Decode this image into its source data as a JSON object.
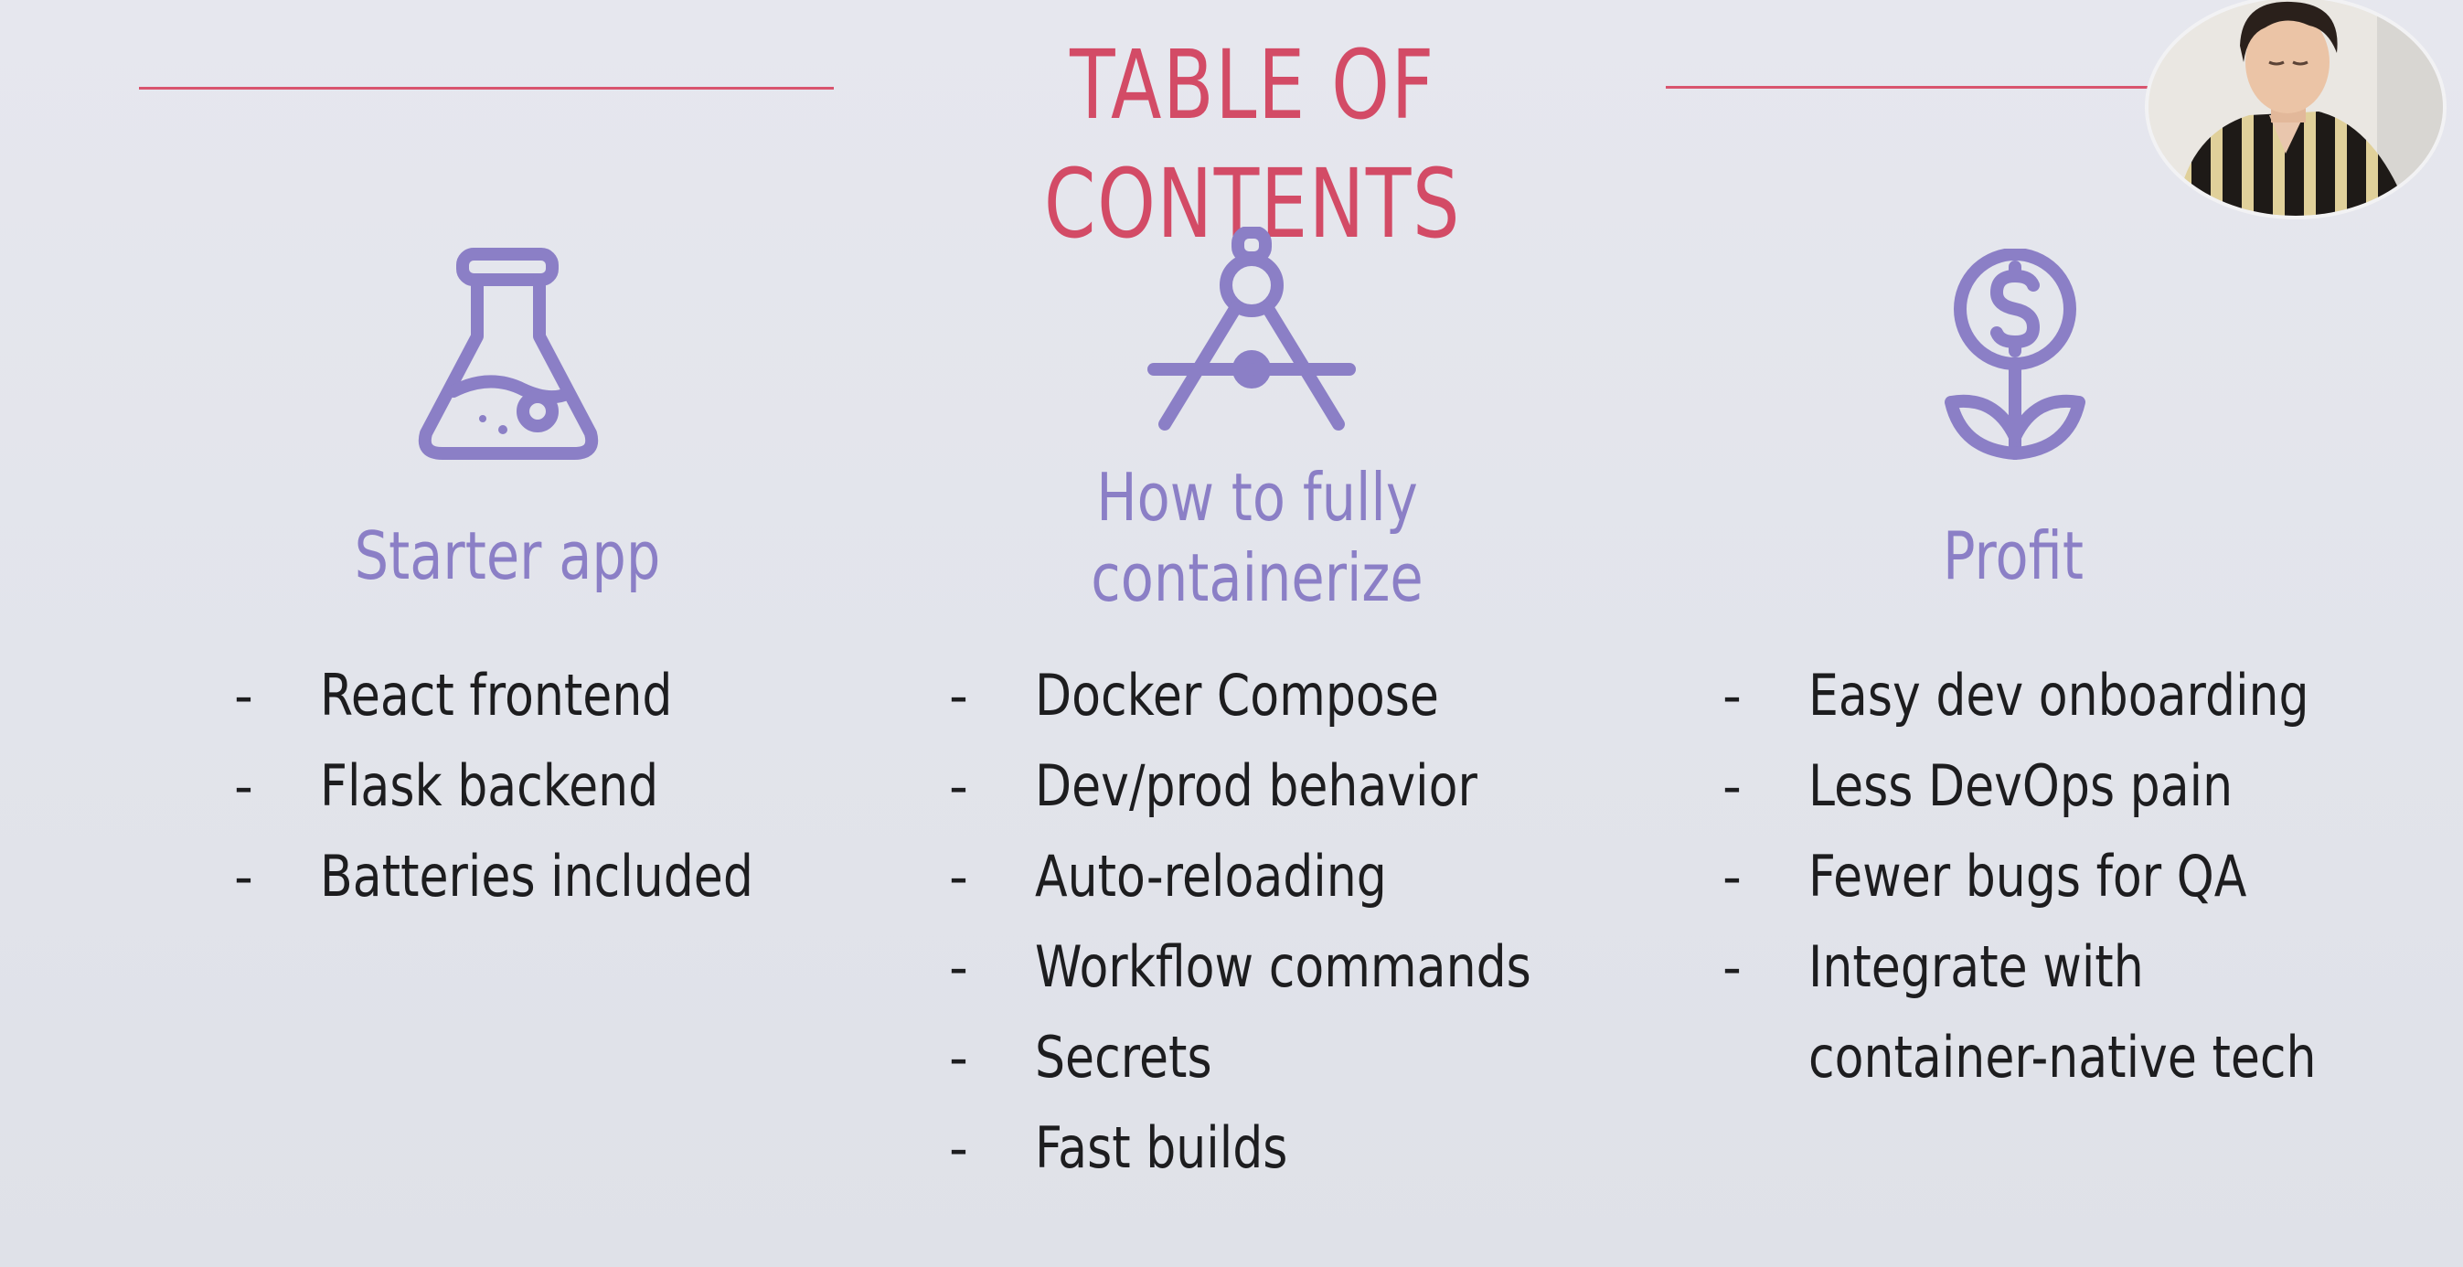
{
  "slide": {
    "title": "TABLE OF CONTENTS",
    "colors": {
      "accent_title": "#d34b66",
      "accent_icon": "#8b7fc6",
      "text": "#1d1d1f",
      "background": "#e4e5ec"
    },
    "columns": [
      {
        "icon": "flask-icon",
        "heading": "Starter app",
        "items": [
          "React frontend",
          "Flask backend",
          "Batteries included"
        ]
      },
      {
        "icon": "compass-icon",
        "heading_line1": "How to fully",
        "heading_line2": "containerize",
        "items": [
          "Docker Compose",
          "Dev/prod behavior",
          "Auto-reloading",
          "Workflow commands",
          "Secrets",
          "Fast builds"
        ]
      },
      {
        "icon": "money-plant-icon",
        "heading": "Profit",
        "items": [
          "Easy dev onboarding",
          "Less DevOps pain",
          "Fewer bugs for QA",
          "Integrate with"
        ],
        "item_continuation": "container-native tech"
      }
    ],
    "bullet": "-"
  }
}
